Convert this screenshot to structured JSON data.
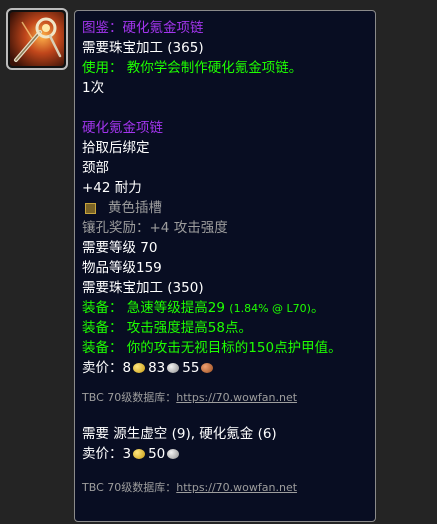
{
  "item_icon": "jewelcrafting-recipe-icon",
  "recipe": {
    "title": "图鉴：硬化氪金项链",
    "requirement": "需要珠宝加工 (365)",
    "use_label": "使用：",
    "use_text": "教你学会制作硬化氪金项链。",
    "charges": "1次"
  },
  "item": {
    "name": "硬化氪金项链",
    "binding": "拾取后绑定",
    "slot": "颈部",
    "stat": "+42 耐力",
    "socket": "黄色插槽",
    "socket_bonus": "镶孔奖励：+4 攻击强度",
    "level_req": "需要等级 70",
    "item_level": "物品等级159",
    "profession_req": "需要珠宝加工 (350)",
    "equip": [
      {
        "label": "装备：",
        "text": "急速等级提高29",
        "note": "(1.84% @ L70)",
        "suffix": "。"
      },
      {
        "label": "装备：",
        "text": "攻击强度提高58点。",
        "note": "",
        "suffix": ""
      },
      {
        "label": "装备：",
        "text": "你的攻击无视目标的150点护甲值。",
        "note": "",
        "suffix": ""
      }
    ],
    "sell_label": "卖价：",
    "sell_gold": "8",
    "sell_silver": "83",
    "sell_copper": "55"
  },
  "source1": {
    "text": "TBC 70级数据库：",
    "link": "https://70.wowfan.net"
  },
  "reagents": {
    "text": "需要 源生虚空 (9), 硬化氪金 (6)",
    "sell_label": "卖价：",
    "sell_gold": "3",
    "sell_silver": "50"
  },
  "source2": {
    "text": "TBC 70级数据库：",
    "link": "https://70.wowfan.net"
  },
  "colors": {
    "epic_purple": "#a335ee",
    "green": "#1eff00",
    "gray": "#9d9d9d",
    "tooltip_bg": "#080d22"
  }
}
